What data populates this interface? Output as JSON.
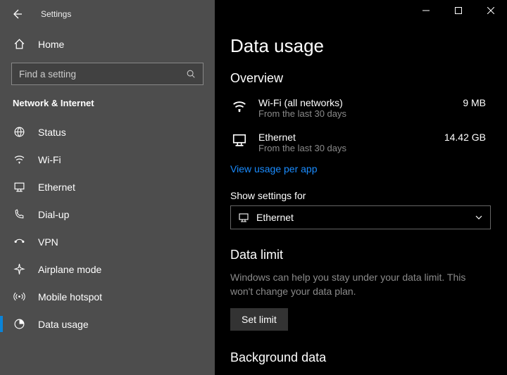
{
  "titlebar": {
    "title": "Settings"
  },
  "home": {
    "label": "Home"
  },
  "search": {
    "placeholder": "Find a setting"
  },
  "section": {
    "header": "Network & Internet"
  },
  "nav": {
    "items": [
      {
        "label": "Status"
      },
      {
        "label": "Wi-Fi"
      },
      {
        "label": "Ethernet"
      },
      {
        "label": "Dial-up"
      },
      {
        "label": "VPN"
      },
      {
        "label": "Airplane mode"
      },
      {
        "label": "Mobile hotspot"
      },
      {
        "label": "Data usage"
      }
    ],
    "active_index": 7
  },
  "page": {
    "title": "Data usage",
    "overview_header": "Overview",
    "usage": [
      {
        "name": "Wi-Fi (all networks)",
        "sub": "From the last 30 days",
        "value": "9 MB"
      },
      {
        "name": "Ethernet",
        "sub": "From the last 30 days",
        "value": "14.42 GB"
      }
    ],
    "view_per_app": "View usage per app",
    "show_settings_label": "Show settings for",
    "dropdown_selected": "Ethernet",
    "data_limit_header": "Data limit",
    "data_limit_desc": "Windows can help you stay under your data limit. This won't change your data plan.",
    "set_limit_button": "Set limit",
    "background_header": "Background data"
  }
}
